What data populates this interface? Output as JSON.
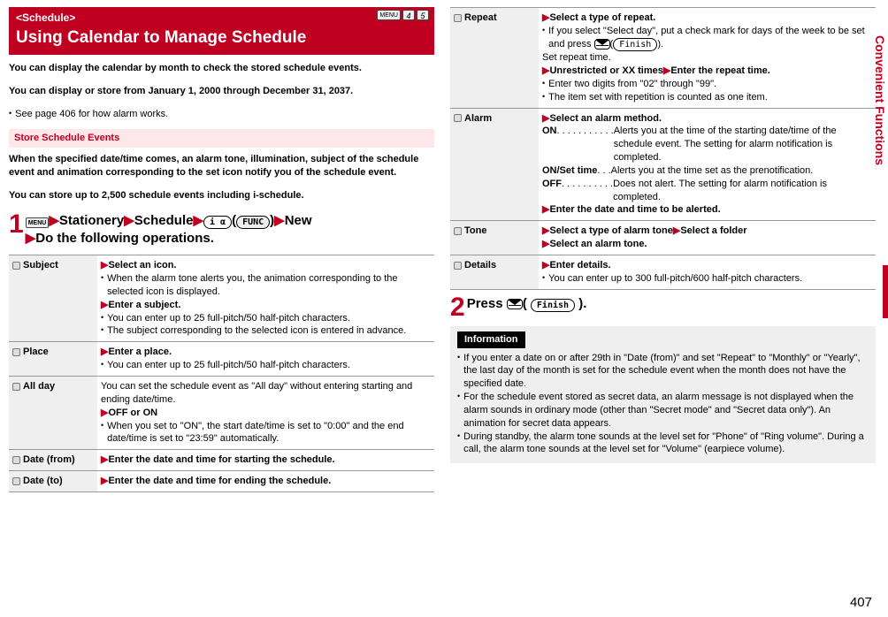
{
  "header": {
    "tag": "<Schedule>",
    "title": "Using Calendar to Manage Schedule",
    "menu_label": "MENU",
    "key1": "4",
    "key2": "5"
  },
  "intro": {
    "p1": "You can display the calendar by month to check the stored schedule events.",
    "p2": "You can display or store from January 1, 2000 through December 31, 2037.",
    "note": "See page 406 for how alarm works."
  },
  "section": {
    "title": "Store Schedule Events",
    "p1": "When the specified date/time comes, an alarm tone, illumination, subject of the schedule event and animation corresponding to the set icon notify you of the schedule event.",
    "p2": "You can store up to 2,500 schedule events including i-schedule."
  },
  "step1": {
    "num": "1",
    "menu": "MENU",
    "t1": "Stationery",
    "t2": "Schedule",
    "btn_alpha": "i α",
    "btn_func": "FUNC",
    "t3": "New",
    "t4": "Do the following operations."
  },
  "step2": {
    "num": "2",
    "t1": "Press ",
    "btn_label": "Finish",
    "t2": "( ",
    "t3": " )."
  },
  "opts_left": [
    {
      "name": "Subject",
      "lines": [
        {
          "b": true,
          "tri": true,
          "text": "Select an icon."
        },
        {
          "bul": true,
          "text": "When the alarm tone alerts you, the animation corresponding to the selected icon is displayed."
        },
        {
          "b": true,
          "tri": true,
          "text": "Enter a subject."
        },
        {
          "bul": true,
          "text": "You can enter up to 25 full-pitch/50 half-pitch characters."
        },
        {
          "bul": true,
          "text": "The subject corresponding to the selected icon is entered in advance."
        }
      ]
    },
    {
      "name": "Place",
      "lines": [
        {
          "b": true,
          "tri": true,
          "text": "Enter a place."
        },
        {
          "bul": true,
          "text": "You can enter up to 25 full-pitch/50 half-pitch characters."
        }
      ]
    },
    {
      "name": "All day",
      "lines": [
        {
          "text": "You can set the schedule event as \"All day\" without entering starting and ending date/time."
        },
        {
          "b": true,
          "tri": true,
          "text": "OFF or ON"
        },
        {
          "bul": true,
          "text": "When you set to \"ON\", the start date/time is set to \"0:00\" and the end date/time is set to \"23:59\" automatically."
        }
      ]
    },
    {
      "name": "Date (from)",
      "lines": [
        {
          "b": true,
          "tri": true,
          "text": "Enter the date and time for starting the schedule."
        }
      ]
    },
    {
      "name": "Date (to)",
      "lines": [
        {
          "b": true,
          "tri": true,
          "text": "Enter the date and time for ending the schedule."
        }
      ]
    }
  ],
  "opts_right": [
    {
      "name": "Repeat",
      "lines": [
        {
          "b": true,
          "tri": true,
          "text": "Select a type of repeat."
        },
        {
          "bul": true,
          "text": "If you select \"Select day\", put a check mark for days of the week to be set and press ",
          "mail": true,
          "btn": "Finish",
          "tail": "."
        },
        {
          "text": "Set repeat time."
        },
        {
          "b": true,
          "tri": true,
          "text": "Unrestricted or XX times",
          "tri2": true,
          "text2": "Enter the repeat time."
        },
        {
          "bul": true,
          "text": "Enter two digits from \"02\" through \"99\"."
        },
        {
          "bul": true,
          "text": "The item set with repetition is counted as one item."
        }
      ]
    },
    {
      "name": "Alarm",
      "lines": [
        {
          "b": true,
          "tri": true,
          "text": "Select an alarm method."
        },
        {
          "def": true,
          "label": "ON",
          "dots": " . . . . . . . . . . . ",
          "desc": "Alerts you at the time of the starting date/time of the schedule event. The setting for alarm notification is completed."
        },
        {
          "def": true,
          "label": "ON/Set time",
          "dots": "  . . . ",
          "desc": "Alerts you at the time set as the prenotification."
        },
        {
          "def": true,
          "label": "OFF",
          "dots": " . . . . . . . . . . ",
          "desc": "Does not alert. The setting for alarm notification is completed."
        },
        {
          "b": true,
          "tri": true,
          "text": "Enter the date and time to be alerted."
        }
      ]
    },
    {
      "name": "Tone",
      "lines": [
        {
          "b": true,
          "tri": true,
          "text": "Select a type of alarm tone",
          "tri2": true,
          "text2": "Select a folder"
        },
        {
          "b": true,
          "tri": true,
          "text": "Select an alarm tone."
        }
      ]
    },
    {
      "name": "Details",
      "lines": [
        {
          "b": true,
          "tri": true,
          "text": "Enter details."
        },
        {
          "bul": true,
          "text": "You can enter up to 300 full-pitch/600 half-pitch characters."
        }
      ]
    }
  ],
  "info": {
    "label": "Information",
    "items": [
      "If you enter a date on or after 29th in \"Date (from)\" and set \"Repeat\" to \"Monthly\" or \"Yearly\", the last day of the month is set for the schedule event when the month does not have the specified date.",
      "For the schedule event stored as secret data, an alarm message is not displayed when the alarm sounds in ordinary mode (other than \"Secret mode\" and \"Secret data only\"). An animation for secret data appears.",
      "During standby, the alarm tone sounds at the level set for \"Phone\" of \"Ring volume\". During a call, the alarm tone sounds at the level set for \"Volume\" (earpiece volume)."
    ]
  },
  "side": {
    "label": "Convenient Functions"
  },
  "page": "407"
}
